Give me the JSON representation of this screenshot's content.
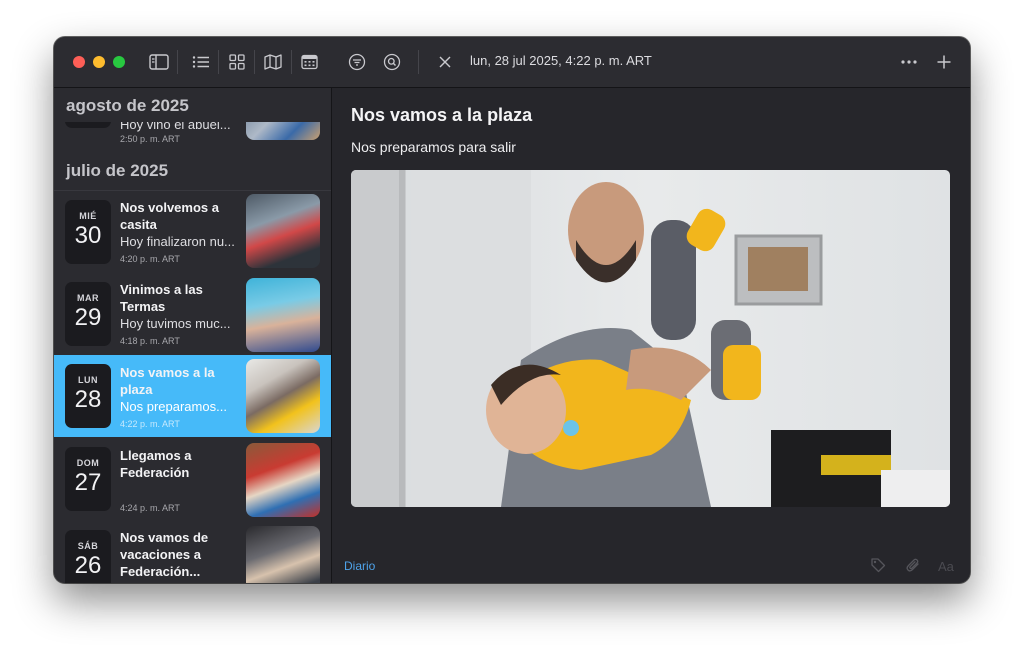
{
  "window": {
    "toolbar_icons": [
      "sidebar-toggle-icon",
      "list-icon",
      "grid-icon",
      "map-icon",
      "calendar-icon",
      "filter-icon",
      "search-icon",
      "close-icon",
      "more-icon",
      "plus-icon"
    ],
    "title": "lun, 28 jul 2025, 4:22 p. m. ART"
  },
  "sidebar": {
    "months": [
      "agosto de 2025",
      "julio de 2025"
    ],
    "partial_entry": {
      "snippet": "Hoy vino el abuel...",
      "time": "2:50 p. m. ART"
    },
    "entries": [
      {
        "dow": "MIÉ",
        "day": "30",
        "title": "Nos volvemos a casita",
        "snippet": "Hoy finalizaron nu...",
        "time": "4:20 p. m. ART"
      },
      {
        "dow": "MAR",
        "day": "29",
        "title": "Vinimos a las Termas",
        "snippet": "Hoy tuvimos muc...",
        "time": "4:18 p. m. ART"
      },
      {
        "dow": "LUN",
        "day": "28",
        "title": "Nos vamos a la plaza",
        "snippet": "Nos preparamos...",
        "time": "4:22 p. m. ART",
        "selected": true
      },
      {
        "dow": "DOM",
        "day": "27",
        "title": "Llegamos a Federación",
        "snippet": "",
        "time": "4:24 p. m. ART"
      },
      {
        "dow": "SÁB",
        "day": "26",
        "title": "Nos vamos de vacaciones a Federación...",
        "snippet": "",
        "time": ""
      }
    ]
  },
  "main": {
    "title": "Nos vamos a la plaza",
    "subtitle": "Nos preparamos para salir",
    "journal": "Diario",
    "bottom_icons": [
      "tag-icon",
      "paperclip-icon"
    ],
    "format_label": "Aa"
  },
  "colors": {
    "accent": "#46baf9",
    "window_bg": "#26262b",
    "sidebar_bg": "#2b2b30",
    "link": "#4ea3ea"
  }
}
